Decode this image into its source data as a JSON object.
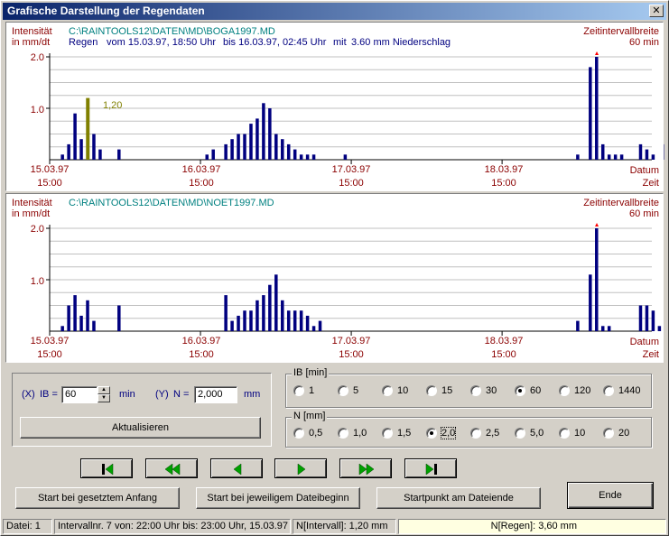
{
  "window": {
    "title": "Grafische Darstellung der Regendaten",
    "close_glyph": "✕"
  },
  "colors": {
    "bar": "#00007f",
    "highlight": "#808000",
    "axis_text": "#8b0000",
    "path_text": "#008080",
    "marker": "#ff0000"
  },
  "chart1": {
    "ylabel_line1": "Intensität",
    "ylabel_line2": "in mm/dt",
    "file": "C:\\RAINTOOLS12\\DATEN\\MD\\BOGA1997.MD",
    "info_regen": "Regen",
    "info_from": "vom 15.03.97, 18:50 Uhr",
    "info_to": "bis 16.03.97, 02:45 Uhr",
    "info_mit": "mit",
    "info_amount": "3.60 mm Niederschlag",
    "interval_label": "Zeitintervallbreite",
    "interval_value": "60 min",
    "highlight_label": "1,20"
  },
  "chart2": {
    "ylabel_line1": "Intensität",
    "ylabel_line2": "in mm/dt",
    "file": "C:\\RAINTOOLS12\\DATEN\\MD\\NOET1997.MD",
    "interval_label": "Zeitintervallbreite",
    "interval_value": "60 min"
  },
  "axis": {
    "yticks": [
      "2.0",
      "1.0"
    ],
    "xticks": [
      {
        "date": "15.03.97",
        "time": "15:00"
      },
      {
        "date": "16.03.97",
        "time": "15:00"
      },
      {
        "date": "17.03.97",
        "time": "15:00"
      },
      {
        "date": "18.03.97",
        "time": "15:00"
      }
    ],
    "xend_line1": "Datum",
    "xend_line2": "Zeit"
  },
  "chart_data": [
    {
      "type": "bar",
      "title": "C:\\RAINTOOLS12\\DATEN\\MD\\BOGA1997.MD",
      "ylabel": "Intensität in mm/dt",
      "xlabel": "Datum Zeit",
      "ylim": [
        0,
        2.0
      ],
      "x_unit": "hours from 15.03.97 15:00",
      "x_ticks": [
        "15.03.97 15:00",
        "16.03.97 15:00",
        "17.03.97 15:00",
        "18.03.97 15:00"
      ],
      "x": [
        2,
        3,
        4,
        5,
        6,
        7,
        8,
        11,
        25,
        26,
        28,
        29,
        30,
        31,
        32,
        33,
        34,
        35,
        36,
        37,
        38,
        39,
        40,
        41,
        42,
        47,
        84,
        86,
        87,
        88,
        89,
        90,
        91,
        94,
        95,
        96,
        98
      ],
      "values": [
        0.1,
        0.3,
        0.9,
        0.4,
        1.2,
        0.5,
        0.2,
        0.2,
        0.1,
        0.2,
        0.3,
        0.4,
        0.5,
        0.5,
        0.7,
        0.8,
        1.1,
        1.0,
        0.5,
        0.4,
        0.3,
        0.2,
        0.1,
        0.1,
        0.1,
        0.1,
        0.1,
        1.8,
        2.0,
        0.3,
        0.1,
        0.1,
        0.1,
        0.3,
        0.2,
        0.1,
        0.3
      ],
      "highlight": {
        "x": 6,
        "value": 1.2,
        "label": "1,20"
      }
    },
    {
      "type": "bar",
      "title": "C:\\RAINTOOLS12\\DATEN\\MD\\NOET1997.MD",
      "ylabel": "Intensität in mm/dt",
      "xlabel": "Datum Zeit",
      "ylim": [
        0,
        2.0
      ],
      "x_unit": "hours from 15.03.97 15:00",
      "x_ticks": [
        "15.03.97 15:00",
        "16.03.97 15:00",
        "17.03.97 15:00",
        "18.03.97 15:00"
      ],
      "x": [
        2,
        3,
        4,
        5,
        6,
        7,
        11,
        28,
        29,
        30,
        31,
        32,
        33,
        34,
        35,
        36,
        37,
        38,
        39,
        40,
        41,
        42,
        43,
        84,
        86,
        87,
        88,
        89,
        94,
        95,
        96,
        97
      ],
      "values": [
        0.1,
        0.5,
        0.7,
        0.3,
        0.6,
        0.2,
        0.5,
        0.7,
        0.2,
        0.3,
        0.4,
        0.4,
        0.6,
        0.7,
        0.9,
        1.1,
        0.6,
        0.4,
        0.4,
        0.4,
        0.3,
        0.1,
        0.2,
        0.2,
        1.1,
        2.0,
        0.1,
        0.1,
        0.5,
        0.5,
        0.4,
        0.1
      ]
    }
  ],
  "controls": {
    "x_label": "(X)",
    "ib_label": "IB =",
    "ib_value": "60",
    "ib_unit": "min",
    "y_label": "(Y)",
    "n_label": "N =",
    "n_value": "2,000",
    "n_unit": "mm",
    "refresh_button": "Aktualisieren",
    "ib_group": {
      "title": "IB [min]",
      "options": [
        "1",
        "5",
        "10",
        "15",
        "30",
        "60",
        "120",
        "1440"
      ],
      "selected": "60"
    },
    "n_group": {
      "title": "N [mm]",
      "options": [
        "0,5",
        "1,0",
        "1,5",
        "2,0",
        "2,5",
        "5,0",
        "10",
        "20"
      ],
      "selected": "2,0"
    }
  },
  "nav": {
    "icons": [
      "first-icon",
      "rewind-icon",
      "previous-icon",
      "next-icon",
      "fast-forward-icon",
      "last-icon"
    ]
  },
  "buttons": {
    "start_set": "Start bei gesetztem Anfang",
    "start_file": "Start bei jeweiligem Dateibeginn",
    "start_end": "Startpunkt am Dateiende",
    "end": "Ende"
  },
  "status": {
    "file": "Datei: 1",
    "interval": "Intervallnr. 7 von: 22:00 Uhr bis: 23:00 Uhr, 15.03.97",
    "n_interval": "N[Intervall]:   1,20 mm",
    "n_regen": "N[Regen]:   3,60 mm"
  }
}
